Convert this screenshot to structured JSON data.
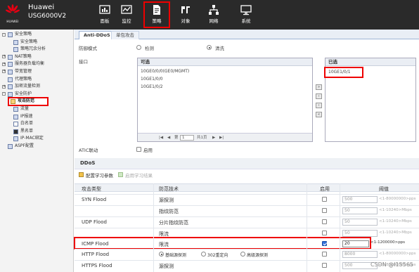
{
  "header": {
    "logo_text": "HUAWEI",
    "brand": "Huawei",
    "model": "USG6000V2",
    "nav": [
      {
        "label": "面板",
        "icon": "dashboard-icon"
      },
      {
        "label": "监控",
        "icon": "monitor-icon"
      },
      {
        "label": "策略",
        "icon": "policy-icon",
        "active": true
      },
      {
        "label": "对象",
        "icon": "object-icon"
      },
      {
        "label": "网络",
        "icon": "network-icon"
      },
      {
        "label": "系统",
        "icon": "system-icon"
      }
    ]
  },
  "sidebar": {
    "items": [
      {
        "label": "安全策略",
        "level": 0,
        "expand": "-"
      },
      {
        "label": "安全策略",
        "level": 1
      },
      {
        "label": "策略冗余分析",
        "level": 1
      },
      {
        "label": "NAT策略",
        "level": 0,
        "expand": "+"
      },
      {
        "label": "服务器负载均衡",
        "level": 0,
        "expand": "+"
      },
      {
        "label": "带宽管理",
        "level": 0,
        "expand": "+"
      },
      {
        "label": "代理策略",
        "level": 0
      },
      {
        "label": "加密流量检测",
        "level": 0,
        "expand": "+"
      },
      {
        "label": "安全防护",
        "level": 0,
        "expand": "-"
      },
      {
        "label": "攻击防范",
        "level": 1,
        "active": true
      },
      {
        "label": "流量",
        "level": 1
      },
      {
        "label": "IP报速",
        "level": 1
      },
      {
        "label": "白名单",
        "level": 1
      },
      {
        "label": "黑名单",
        "level": 1
      },
      {
        "label": "IP-MAC绑定",
        "level": 1
      },
      {
        "label": "ASPF配置",
        "level": 0
      }
    ]
  },
  "tabs": [
    {
      "label": "Anti-DDoS",
      "active": true
    },
    {
      "label": "单包攻击"
    }
  ],
  "form": {
    "mode_label": "防御模式",
    "mode_options": [
      "检测",
      "清洗"
    ],
    "mode_selected": "清洗",
    "iface_label": "接口",
    "available_title": "可选",
    "available": [
      "10GE0/0/0(GE0/MGMT)",
      "10GE1/0/0",
      "10GE1/0/2"
    ],
    "selected_title": "已选",
    "selected": [
      "10GE1/0/1"
    ],
    "pager_page": "1",
    "pager_text": "第",
    "pager_total": "共1页",
    "move_buttons": [
      "»",
      "›",
      "‹",
      "«"
    ],
    "atic_label": "ATIC联动",
    "atic_option": "启用"
  },
  "ddos": {
    "section_title": "DDoS",
    "toolbar": {
      "config_label": "配置学习参数",
      "apply_label": "启用学习结果"
    },
    "headers": {
      "type": "攻击类型",
      "tech": "防范技术",
      "enable": "启用",
      "threshold": "阈值"
    },
    "rows": [
      {
        "type": "SYN Flood",
        "tech": "源探测",
        "enabled": false,
        "value": "500",
        "range": "<1-80000000>pps"
      },
      {
        "type": "",
        "tech": "指纹防范",
        "enabled": false,
        "value": "50",
        "range": "<1-10240>Mbps"
      },
      {
        "type": "UDP Flood",
        "tech": "分片指纹防范",
        "enabled": false,
        "value": "50",
        "range": "<1-10240>Mbps"
      },
      {
        "type": "",
        "tech": "限流",
        "enabled": false,
        "value": "50",
        "range": "<1-10240>Mbps"
      },
      {
        "type": "ICMP Flood",
        "tech": "限流",
        "enabled": true,
        "value": "20",
        "range": "<1-1200000>pps"
      },
      {
        "type": "HTTP Flood",
        "tech_options": [
          "基础源探测",
          "302重定向",
          "高级源探测"
        ],
        "enabled": false,
        "value": "8000",
        "range": "<1-80000000>pps"
      },
      {
        "type": "HTTPS Flood",
        "tech": "源探测",
        "enabled": false,
        "value": "500",
        "range": "<1-80000000>pps"
      }
    ]
  },
  "watermark": "CSDN @l15565"
}
